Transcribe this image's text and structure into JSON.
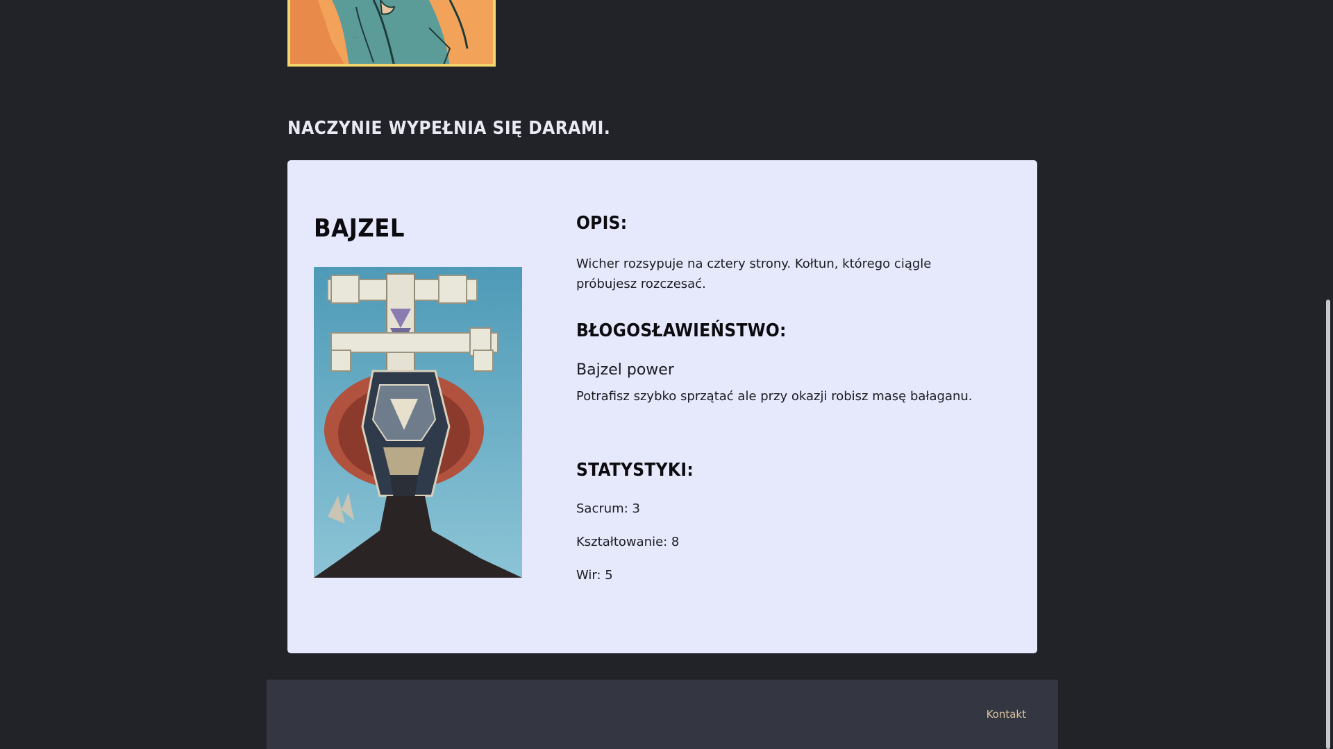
{
  "section": {
    "heading": "Naczynie wypełnia się darami."
  },
  "card": {
    "title": "Bajzel",
    "description_label": "Opis:",
    "description": "Wicher rozsypuje na cztery strony. Kołtun, którego ciągle próbujesz rozczesać.",
    "blessing_label": "Błogosławieństwo:",
    "power_name": "Bajzel power",
    "power_description": "Potrafisz szybko sprzątać ale przy okazji robisz masę bałaganu.",
    "stats_label": "Statystyki:",
    "stats": [
      "Sacrum: 3",
      "Kształtowanie: 8",
      "Wir: 5"
    ]
  },
  "footer": {
    "contact_link": "Kontakt"
  },
  "colors": {
    "page_background": "#212329",
    "card_background": "#e6e8fb",
    "footer_background": "#343741",
    "footer_link": "#d9c3a0"
  }
}
